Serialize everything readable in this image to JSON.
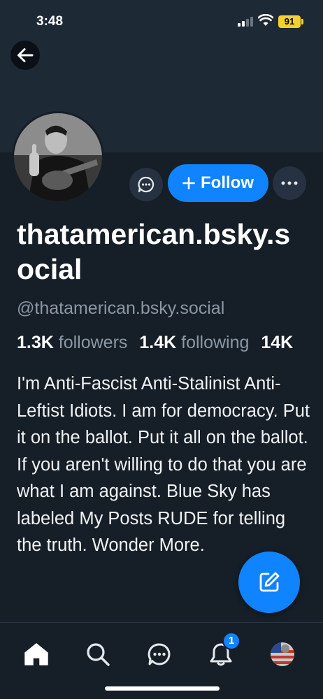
{
  "status_bar": {
    "time": "3:48",
    "battery": "91"
  },
  "profile": {
    "display_name": "thatamerican.bsky.social",
    "handle": "@thatamerican.bsky.social",
    "followers_count": "1.3K",
    "followers_label": "followers",
    "following_count": "1.4K",
    "following_label": "following",
    "posts_count": "14K",
    "bio": "I'm Anti-Fascist Anti-Stalinist Anti-Leftist Idiots. I am for democracy. Put it on the ballot. Put it all on the ballot. If you aren't willing to do that you are what I am against. Blue Sky has labeled My Posts RUDE for telling the truth. Wonder More."
  },
  "actions": {
    "follow_label": "Follow"
  },
  "tabbar": {
    "notification_badge": "1"
  },
  "colors": {
    "accent": "#1083fe",
    "background": "#161e27",
    "banner": "#1e2936",
    "muted": "#8b98a5"
  }
}
